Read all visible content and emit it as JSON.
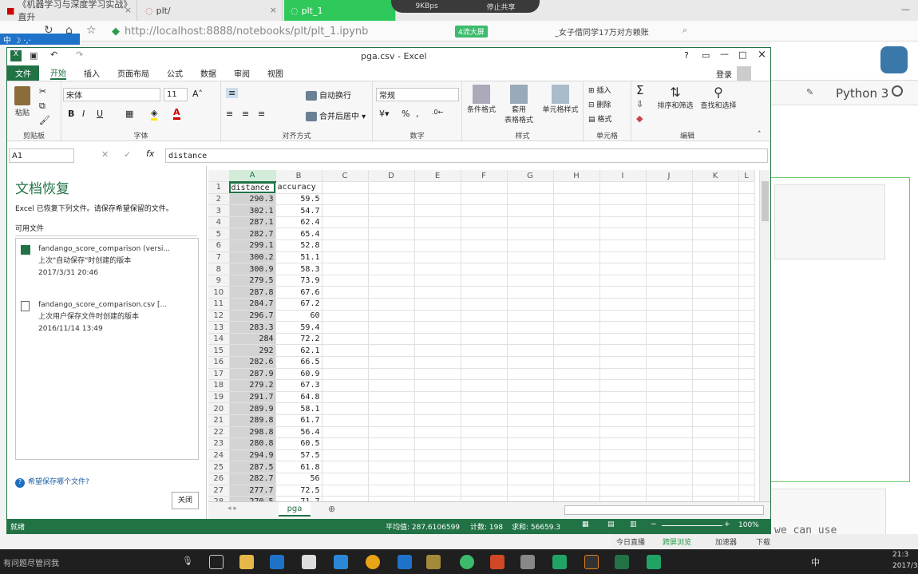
{
  "browser": {
    "tabs": [
      "《机器学习与深度学习实战》直升",
      "plt/",
      "plt_1"
    ],
    "net_speed": "9KBps",
    "stop_share": "停止共享",
    "url": "http://localhost:8888/notebooks/plt/plt_1.ipynb",
    "big_screen": "4流大屏",
    "news": "_女子借同学17万对方赖账"
  },
  "jupyter": {
    "kernel": "Python 3",
    "code_frag": "we can use"
  },
  "excel": {
    "title": "pga.csv - Excel",
    "login": "登录",
    "ribbon_tabs": [
      "文件",
      "开始",
      "插入",
      "页面布局",
      "公式",
      "数据",
      "审阅",
      "视图"
    ],
    "font_name": "宋体",
    "font_size": "11",
    "wrap": "自动换行",
    "merge": "合并后居中",
    "num_format": "常规",
    "paste": "粘贴",
    "cond_format": "条件格式",
    "table_format": "套用\n表格格式",
    "cell_styles": "单元格样式",
    "insert": "插入",
    "delete": "删除",
    "format": "格式",
    "sort": "排序和筛选",
    "find": "查找和选择",
    "groups": [
      "剪贴板",
      "字体",
      "对齐方式",
      "数字",
      "样式",
      "单元格",
      "编辑"
    ],
    "name_box": "A1",
    "formula": "distance",
    "recovery": {
      "title": "文档恢复",
      "desc": "Excel 已恢复下列文件。请保存希望保留的文件。",
      "available": "可用文件",
      "files": [
        {
          "name": "fandango_score_comparison (versi...",
          "info": "上次\"自动保存\"时创建的版本",
          "date": "2017/3/31 20:46"
        },
        {
          "name": "fandango_score_comparison.csv  [...",
          "info": "上次用户保存文件时创建的版本",
          "date": "2016/11/14 13:49"
        }
      ],
      "which": "希望保存哪个文件?",
      "close": "关闭"
    },
    "cols": [
      "A",
      "B",
      "C",
      "D",
      "E",
      "F",
      "G",
      "H",
      "I",
      "J",
      "K",
      "L"
    ],
    "header_row": [
      "distance",
      "accuracy"
    ],
    "rows": [
      [
        "290.3",
        "59.5"
      ],
      [
        "302.1",
        "54.7"
      ],
      [
        "287.1",
        "62.4"
      ],
      [
        "282.7",
        "65.4"
      ],
      [
        "299.1",
        "52.8"
      ],
      [
        "300.2",
        "51.1"
      ],
      [
        "300.9",
        "58.3"
      ],
      [
        "279.5",
        "73.9"
      ],
      [
        "287.8",
        "67.6"
      ],
      [
        "284.7",
        "67.2"
      ],
      [
        "296.7",
        "60"
      ],
      [
        "283.3",
        "59.4"
      ],
      [
        "284",
        "72.2"
      ],
      [
        "292",
        "62.1"
      ],
      [
        "282.6",
        "66.5"
      ],
      [
        "287.9",
        "60.9"
      ],
      [
        "279.2",
        "67.3"
      ],
      [
        "291.7",
        "64.8"
      ],
      [
        "289.9",
        "58.1"
      ],
      [
        "289.8",
        "61.7"
      ],
      [
        "298.8",
        "56.4"
      ],
      [
        "280.8",
        "60.5"
      ],
      [
        "294.9",
        "57.5"
      ],
      [
        "287.5",
        "61.8"
      ],
      [
        "282.7",
        "56"
      ],
      [
        "277.7",
        "72.5"
      ],
      [
        "270.5",
        "71.7"
      ]
    ],
    "sheet": "pga",
    "status": {
      "ready": "就绪",
      "avg": "平均值: 287.6106599",
      "count": "计数: 198",
      "sum": "求和: 56659.3",
      "zoom": "100%"
    }
  },
  "tray": {
    "items": [
      "今日直播",
      "跨屏浏览",
      "加速器",
      "下载"
    ]
  },
  "taskbar": {
    "search": "有问题尽管问我",
    "ime": "中",
    "time": "21:3",
    "date": "2017/3"
  }
}
